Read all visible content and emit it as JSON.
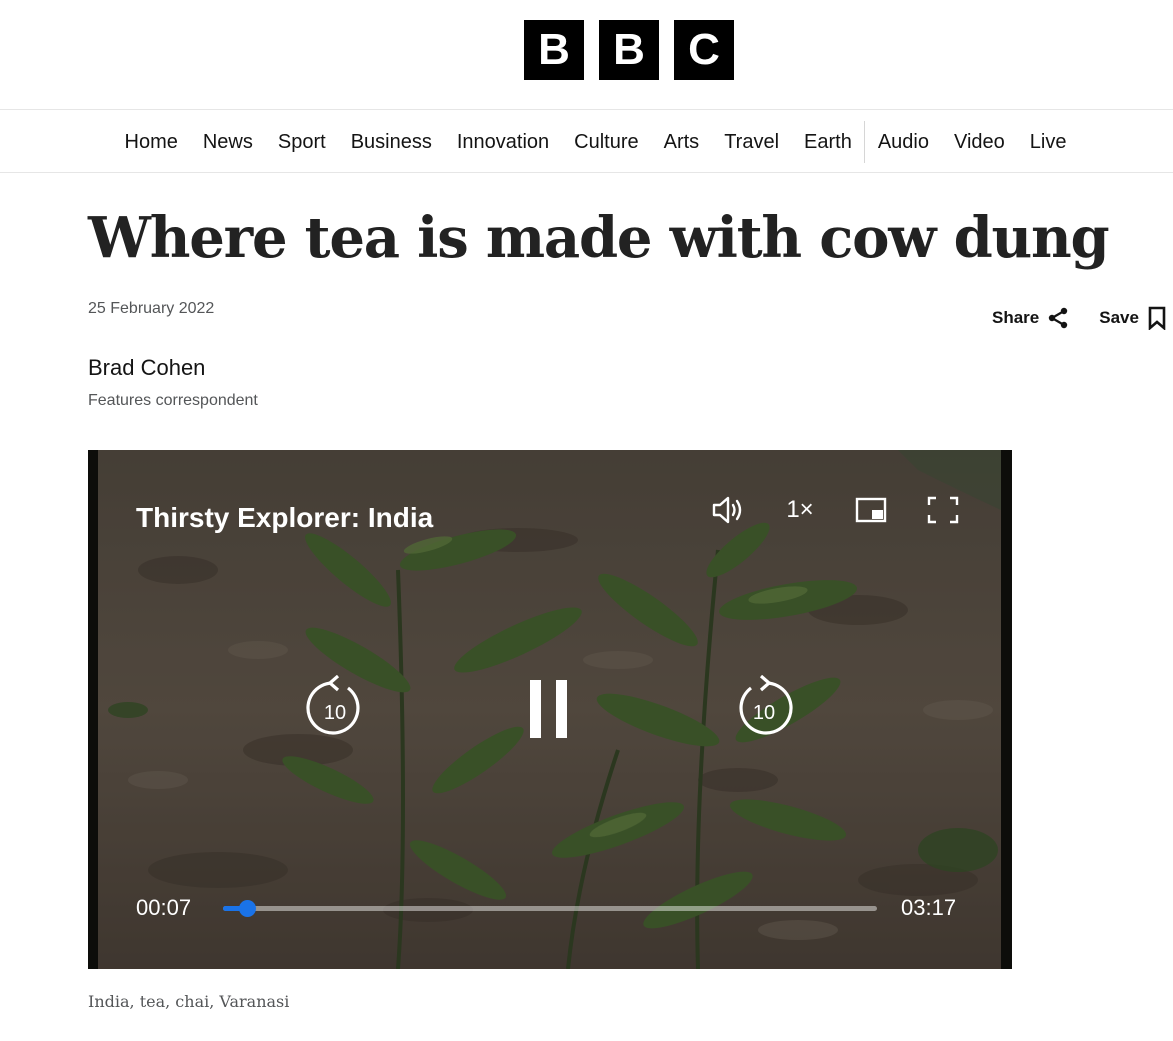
{
  "logo": {
    "letters": [
      "B",
      "B",
      "C"
    ]
  },
  "nav": {
    "items": [
      "Home",
      "News",
      "Sport",
      "Business",
      "Innovation",
      "Culture",
      "Arts",
      "Travel",
      "Earth"
    ],
    "items_right": [
      "Audio",
      "Video",
      "Live"
    ]
  },
  "article": {
    "headline": "Where tea is made with cow dung",
    "date": "25 February 2022",
    "author": "Brad Cohen",
    "role": "Features correspondent",
    "tags": "India, tea, chai, Varanasi"
  },
  "actions": {
    "share_label": "Share",
    "save_label": "Save"
  },
  "video": {
    "title": "Thirsty Explorer: India",
    "speed": "1×",
    "current_time": "00:07",
    "duration": "03:17",
    "rewind_label": "10",
    "forward_label": "10",
    "progress_fraction": 0.036,
    "accent_color": "#1a73e8",
    "icons": [
      "volume-icon",
      "picture-in-picture-icon",
      "fullscreen-icon",
      "rewind-10-icon",
      "pause-icon",
      "forward-10-icon"
    ]
  }
}
